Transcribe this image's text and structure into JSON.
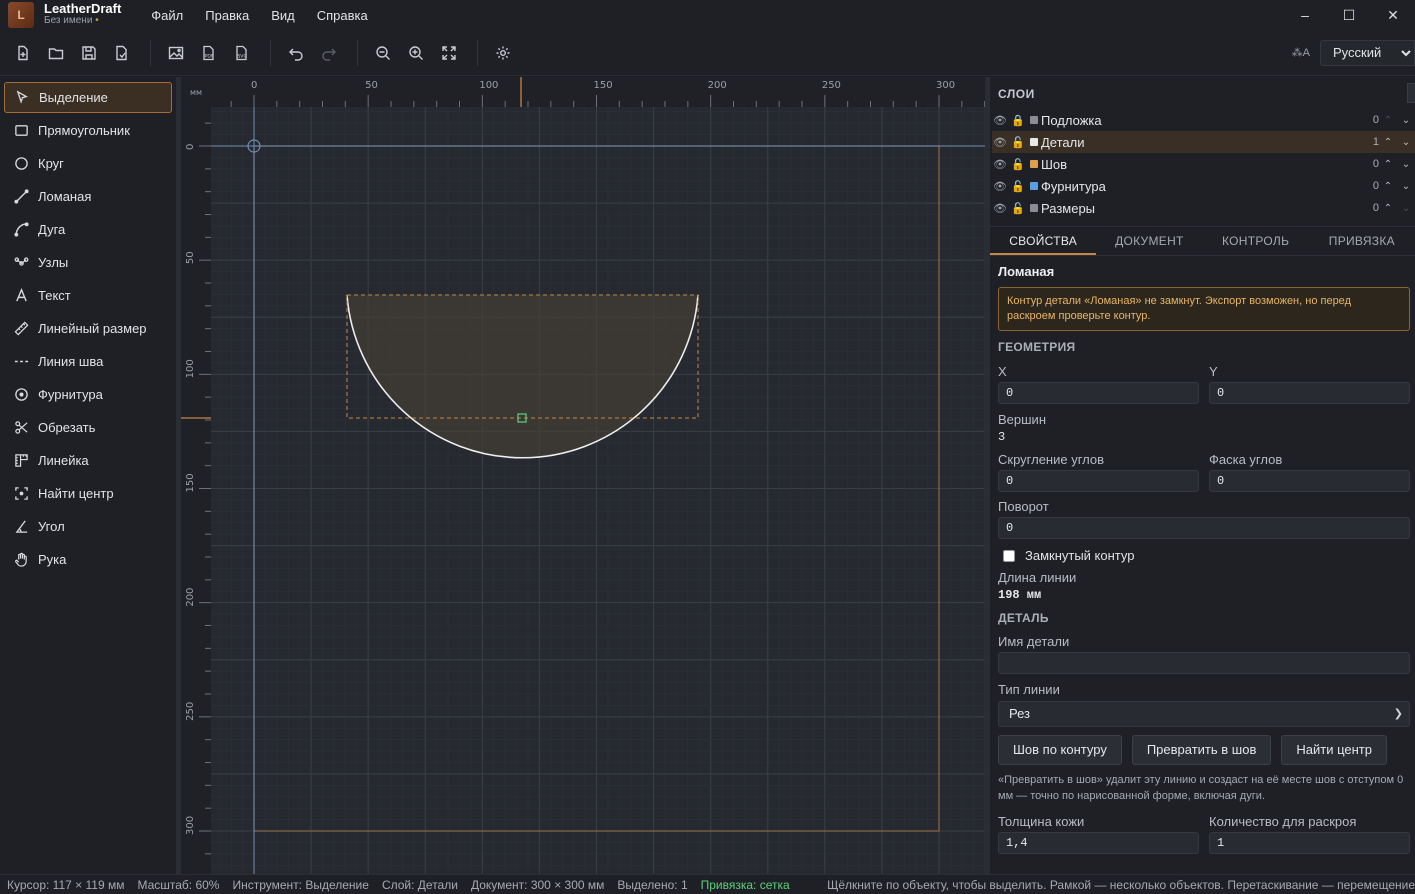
{
  "app": {
    "name": "LeatherDraft",
    "doc": "Без имени",
    "dirty_dot": "•",
    "logo": "L"
  },
  "menu": [
    "Файл",
    "Правка",
    "Вид",
    "Справка"
  ],
  "window_controls": {
    "minimize": "–",
    "maximize": "☐",
    "close": "✕"
  },
  "language": {
    "glyph": "⁂A",
    "selected": "Русский"
  },
  "tools": [
    {
      "id": "select",
      "label": "Выделение",
      "active": true
    },
    {
      "id": "rect",
      "label": "Прямоугольник"
    },
    {
      "id": "circle",
      "label": "Круг"
    },
    {
      "id": "polyline",
      "label": "Ломаная"
    },
    {
      "id": "arc",
      "label": "Дуга"
    },
    {
      "id": "nodes",
      "label": "Узлы"
    },
    {
      "id": "text",
      "label": "Текст"
    },
    {
      "id": "dim",
      "label": "Линейный размер"
    },
    {
      "id": "seam",
      "label": "Линия шва"
    },
    {
      "id": "hardware",
      "label": "Фурнитура"
    },
    {
      "id": "cut",
      "label": "Обрезать"
    },
    {
      "id": "ruler",
      "label": "Линейка"
    },
    {
      "id": "center",
      "label": "Найти центр"
    },
    {
      "id": "angle",
      "label": "Угол"
    },
    {
      "id": "hand",
      "label": "Рука"
    }
  ],
  "ruler": {
    "unit": "мм",
    "x_ticks": [
      "0",
      "50",
      "100",
      "150",
      "200",
      "250",
      "300"
    ],
    "y_ticks": [
      "0",
      "50",
      "100",
      "150",
      "200",
      "250",
      "300"
    ]
  },
  "layers": {
    "title": "СЛОИ",
    "items": [
      {
        "name": "Подложка",
        "color": "#8a8d93",
        "count": "0",
        "locked": true
      },
      {
        "name": "Детали",
        "color": "#e8e8e8",
        "count": "1",
        "locked": false,
        "selected": true
      },
      {
        "name": "Шов",
        "color": "#e0a050",
        "count": "0",
        "locked": false
      },
      {
        "name": "Фурнитура",
        "color": "#5aa0e0",
        "count": "0",
        "locked": false
      },
      {
        "name": "Размеры",
        "color": "#8a8d93",
        "count": "0",
        "locked": false
      }
    ]
  },
  "tabs": [
    "СВОЙСТВА",
    "ДОКУМЕНТ",
    "КОНТРОЛЬ",
    "ПРИВЯЗКА"
  ],
  "props": {
    "title": "Ломаная",
    "warning": "Контур детали «Ломаная» не замкнут. Экспорт возможен, но перед раскроем проверьте контур.",
    "geometry_title": "ГЕОМЕТРИЯ",
    "x_label": "X",
    "x_value": "0",
    "y_label": "Y",
    "y_value": "0",
    "vertices_label": "Вершин",
    "vertices_value": "3",
    "round_label": "Скругление углов",
    "round_value": "0",
    "chamfer_label": "Фаска углов",
    "chamfer_value": "0",
    "rotation_label": "Поворот",
    "rotation_value": "0",
    "closed_label": "Замкнутый контур",
    "length_label": "Длина линии",
    "length_value": "198 мм",
    "detail_title": "ДЕТАЛЬ",
    "name_label": "Имя детали",
    "name_value": "",
    "linetype_label": "Тип линии",
    "linetype_value": "Рез",
    "btn_seam": "Шов по контуру",
    "btn_convert": "Превратить в шов",
    "btn_center": "Найти центр",
    "note": "«Превратить в шов» удалит эту линию и создаст на её месте шов с отступом 0 мм — точно по нарисованной форме, включая дуги.",
    "thickness_label": "Толщина кожи",
    "thickness_value": "1,4",
    "qty_label": "Количество для раскроя",
    "qty_value": "1"
  },
  "status": {
    "cursor": "Курсор: 117 × 119 мм",
    "zoom": "Масштаб: 60%",
    "tool": "Инструмент: Выделение",
    "layer": "Слой: Детали",
    "document": "Документ: 300 × 300 мм",
    "selected": "Выделено: 1",
    "snap": "Привязка: сетка",
    "hint": "Щёлкните по объекту, чтобы выделить. Рамкой — несколько объектов. Перетаскивание — перемещение"
  },
  "colors": {
    "accent": "#c28746",
    "snap": "#5bd17d",
    "warning": "#e7b568"
  }
}
